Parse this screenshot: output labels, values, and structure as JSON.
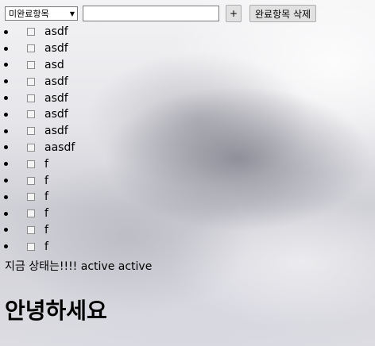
{
  "toolbar": {
    "filter_selected": "미완료항목",
    "filter_arrow_icon": "triangle-down-icon",
    "input_value": "",
    "add_label": "+",
    "delete_completed_label": "완료항목 삭제"
  },
  "todos": [
    {
      "label": "asdf",
      "checked": false
    },
    {
      "label": "asdf",
      "checked": false
    },
    {
      "label": "asd",
      "checked": false
    },
    {
      "label": "asdf",
      "checked": false
    },
    {
      "label": "asdf",
      "checked": false
    },
    {
      "label": "asdf",
      "checked": false
    },
    {
      "label": "asdf",
      "checked": false
    },
    {
      "label": "aasdf",
      "checked": false
    },
    {
      "label": "f",
      "checked": false
    },
    {
      "label": "f",
      "checked": false
    },
    {
      "label": "f",
      "checked": false
    },
    {
      "label": "f",
      "checked": false
    },
    {
      "label": "f",
      "checked": false
    },
    {
      "label": "f",
      "checked": false
    }
  ],
  "status_text": "지금 상태는!!!! active active",
  "greeting": "안녕하세요"
}
